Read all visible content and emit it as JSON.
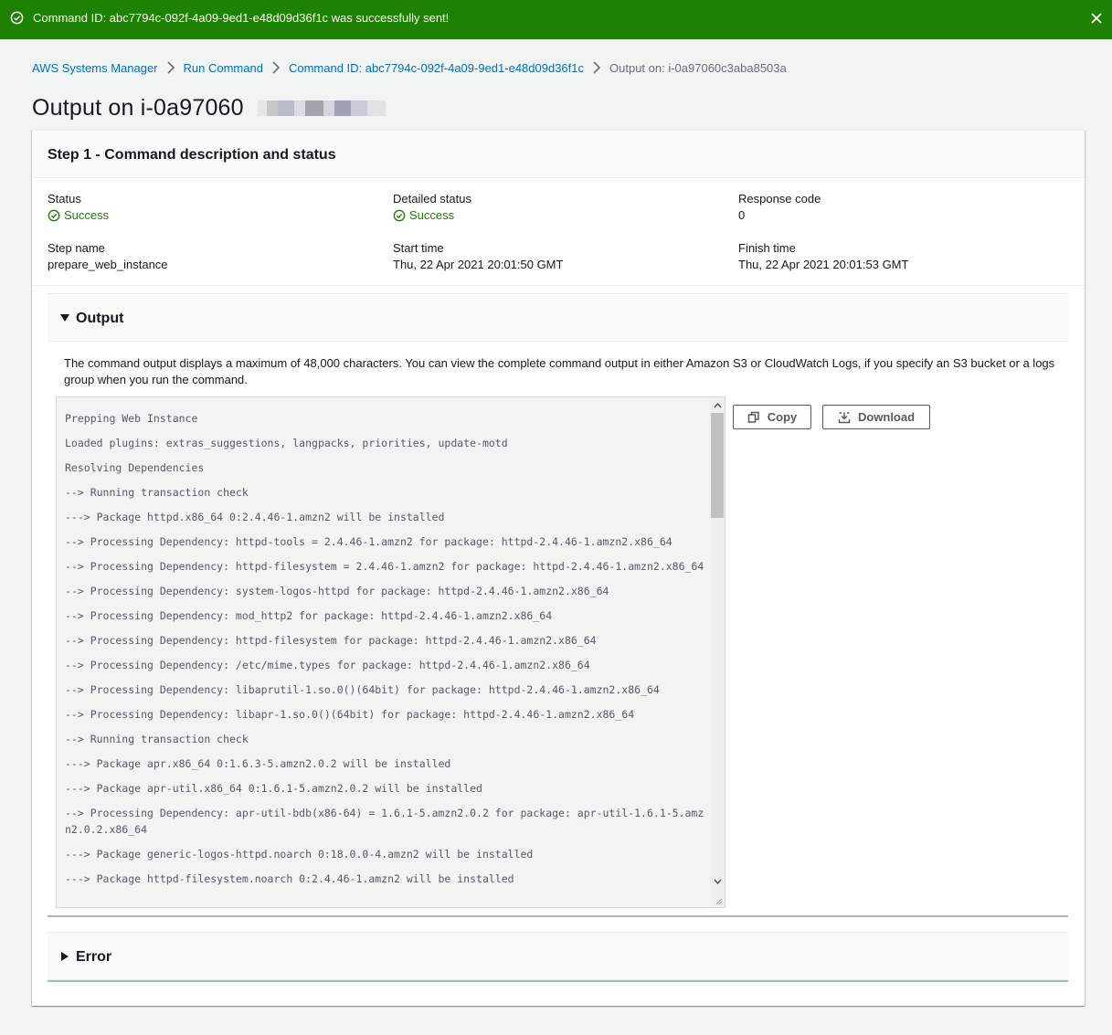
{
  "flash": {
    "message": "Command ID: abc7794c-092f-4a09-9ed1-e48d09d36f1c was successfully sent!",
    "color": "#1d8102"
  },
  "breadcrumb": [
    {
      "label": "AWS Systems Manager"
    },
    {
      "label": "Run Command"
    },
    {
      "label": "Command ID: abc7794c-092f-4a09-9ed1-e48d09d36f1c"
    },
    {
      "label": "Output on: i-0a97060c3aba8503a"
    }
  ],
  "page": {
    "title": "Output on i-0a97060"
  },
  "step": {
    "title": "Step 1 - Command description and status",
    "fields": {
      "status": {
        "label": "Status",
        "value": "Success"
      },
      "detailed_status": {
        "label": "Detailed status",
        "value": "Success"
      },
      "response_code": {
        "label": "Response code",
        "value": "0"
      },
      "step_name": {
        "label": "Step name",
        "value": "prepare_web_instance"
      },
      "start_time": {
        "label": "Start time",
        "value": "Thu, 22 Apr 2021 20:01:50 GMT"
      },
      "finish_time": {
        "label": "Finish time",
        "value": "Thu, 22 Apr 2021 20:01:53 GMT"
      }
    }
  },
  "output": {
    "title": "Output",
    "note": "The command output displays a maximum of 48,000 characters. You can view the complete command output in either Amazon S3 or CloudWatch Logs, if you specify an S3 bucket or a logs group when you run the command.",
    "copy_label": "Copy",
    "download_label": "Download",
    "lines": [
      "Prepping Web Instance",
      "Loaded plugins: extras_suggestions, langpacks, priorities, update-motd",
      "Resolving Dependencies",
      "--> Running transaction check",
      "---> Package httpd.x86_64 0:2.4.46-1.amzn2 will be installed",
      "--> Processing Dependency: httpd-tools = 2.4.46-1.amzn2 for package: httpd-2.4.46-1.amzn2.x86_64",
      "--> Processing Dependency: httpd-filesystem = 2.4.46-1.amzn2 for package: httpd-2.4.46-1.amzn2.x86_64",
      "--> Processing Dependency: system-logos-httpd for package: httpd-2.4.46-1.amzn2.x86_64",
      "--> Processing Dependency: mod_http2 for package: httpd-2.4.46-1.amzn2.x86_64",
      "--> Processing Dependency: httpd-filesystem for package: httpd-2.4.46-1.amzn2.x86_64",
      "--> Processing Dependency: /etc/mime.types for package: httpd-2.4.46-1.amzn2.x86_64",
      "--> Processing Dependency: libaprutil-1.so.0()(64bit) for package: httpd-2.4.46-1.amzn2.x86_64",
      "--> Processing Dependency: libapr-1.so.0()(64bit) for package: httpd-2.4.46-1.amzn2.x86_64",
      "--> Running transaction check",
      "---> Package apr.x86_64 0:1.6.3-5.amzn2.0.2 will be installed",
      "---> Package apr-util.x86_64 0:1.6.1-5.amzn2.0.2 will be installed",
      "--> Processing Dependency: apr-util-bdb(x86-64) = 1.6.1-5.amzn2.0.2 for package: apr-util-1.6.1-5.amzn2.0.2.x86_64",
      "---> Package generic-logos-httpd.noarch 0:18.0.0-4.amzn2 will be installed",
      "---> Package httpd-filesystem.noarch 0:2.4.46-1.amzn2 will be installed"
    ]
  },
  "error": {
    "title": "Error"
  }
}
